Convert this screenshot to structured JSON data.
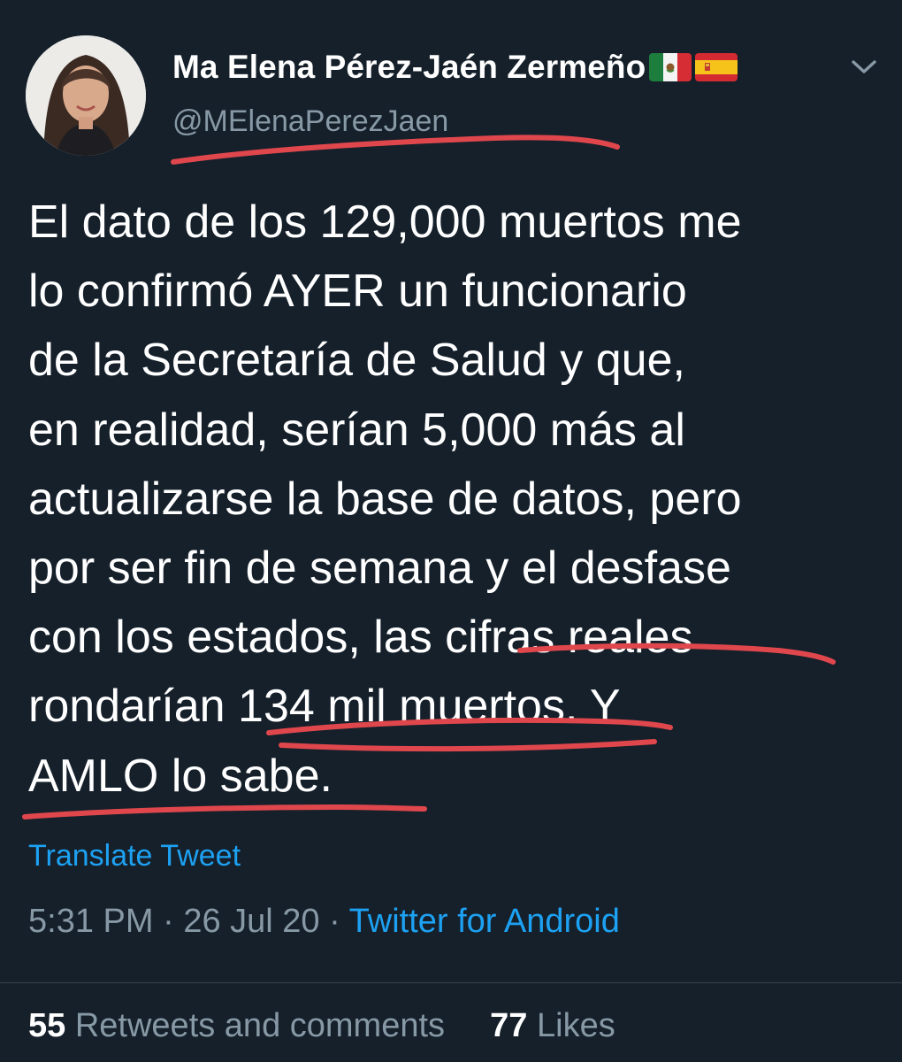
{
  "tweet": {
    "display_name": "Ma Elena Pérez-Jaén Zermeño",
    "handle": "@MElenaPerezJaen",
    "flags": [
      "mexico-flag",
      "spain-flag"
    ],
    "menu_icon": "chevron-down-icon",
    "body_lines": [
      "El dato de los 129,000 muertos me",
      "lo confirmó AYER un funcionario",
      "de la Secretaría de Salud y que,",
      "en realidad, serían 5,000 más al",
      "actualizarse la base de datos, pero",
      "por ser fin de semana y el desfase",
      "con los estados, las cifras reales",
      "rondarían 134 mil muertos. Y",
      "AMLO lo sabe."
    ],
    "translate_label": "Translate Tweet",
    "time": "5:31 PM",
    "separator": "·",
    "date": "26 Jul 20",
    "source": "Twitter for Android",
    "retweets_count": "55",
    "retweets_label": "Retweets and comments",
    "likes_count": "77",
    "likes_label": "Likes"
  },
  "colors": {
    "background": "#15202b",
    "text": "#ffffff",
    "secondary": "#8899a6",
    "link": "#1da1f2",
    "annotation": "#e0474c"
  }
}
